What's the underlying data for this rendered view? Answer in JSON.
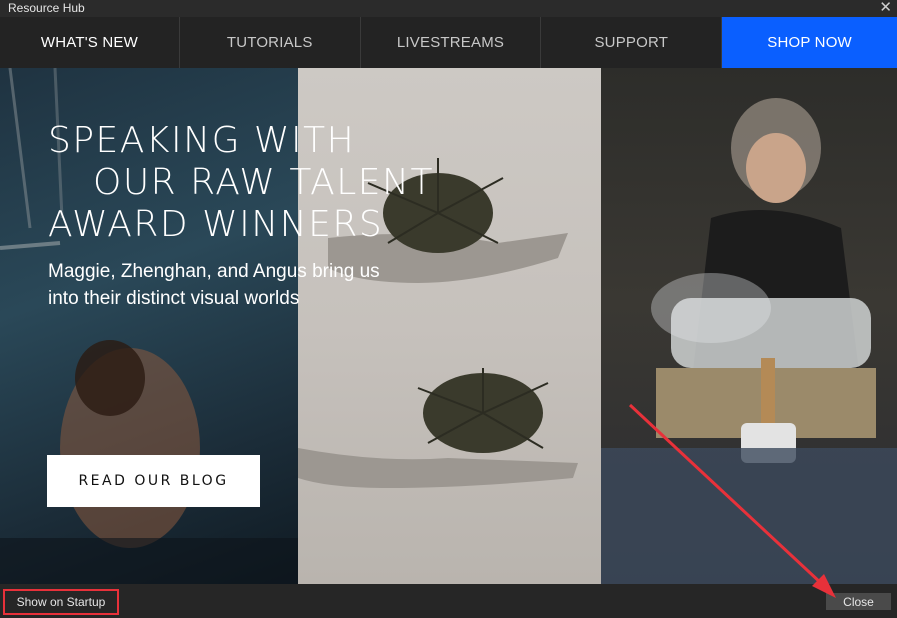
{
  "window": {
    "title": "Resource Hub"
  },
  "nav": {
    "tabs": [
      {
        "label": "WHAT'S NEW"
      },
      {
        "label": "TUTORIALS"
      },
      {
        "label": "LIVESTREAMS"
      },
      {
        "label": "SUPPORT"
      },
      {
        "label": "SHOP NOW"
      }
    ]
  },
  "hero": {
    "heading_lines": [
      "SPEAKING WITH",
      "OUR RAW TALENT",
      "AWARD WINNERS"
    ],
    "subtitle_lines": [
      "Maggie, Zhenghan, and Angus bring us",
      "into their distinct visual worlds"
    ],
    "button_label": "READ OUR BLOG"
  },
  "footer": {
    "startup_label": "Show on Startup",
    "close_label": "Close"
  },
  "colors": {
    "accent": "#0a5fff",
    "highlight": "#e8313a"
  }
}
